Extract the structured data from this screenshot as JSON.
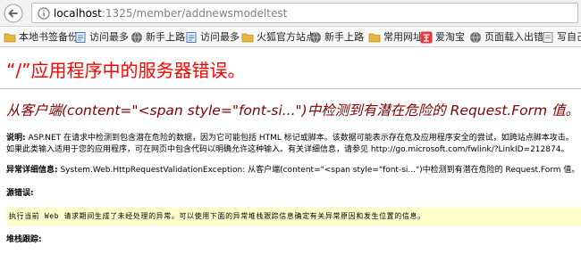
{
  "browser": {
    "url_host": "localhost",
    "url_path": ":1325/member/addnewsmodeltest",
    "bookmarks": [
      {
        "label": "本地书签备份",
        "icon": "folder-icon"
      },
      {
        "label": "访问最多",
        "icon": "bookmark-page-icon"
      },
      {
        "label": "新手上路",
        "icon": "globe-icon"
      },
      {
        "label": "访问最多",
        "icon": "bookmark-page-icon"
      },
      {
        "label": "火狐官方站点",
        "icon": "folder-icon"
      },
      {
        "label": "新手上路",
        "icon": "globe-icon"
      },
      {
        "label": "常用网址",
        "icon": "folder-icon"
      },
      {
        "label": "爱淘宝",
        "icon": "taobao-icon"
      },
      {
        "label": "页面载入出错",
        "icon": "globe-icon"
      },
      {
        "label": "写自己",
        "icon": "page-icon"
      }
    ],
    "colors": {
      "folder": "#e6b83a",
      "taobao": "#e4393c"
    }
  },
  "error_page": {
    "title": "“/”应用程序中的服务器错误。",
    "subtitle": "从客户端(content=\"<span style=\"font-si...\")中检测到有潜在危险的 Request.Form 值。",
    "description_label": "说明:",
    "description_text": " ASP.NET 在请求中检测到包含潜在危险的数据，因为它可能包括 HTML 标记或脚本。该数据可能表示存在危及应用程序安全的尝试，如跨站点脚本攻击。如果此类输入适用于您的应用程序，可在网页中包含代码以明确允许这种输入。有关详细信息，请参见 http://go.microsoft.com/fwlink/?LinkID=212874。",
    "exception_label": "异常详细信息:",
    "exception_text": " System.Web.HttpRequestValidationException: 从客户端(content=\"<span style=\"font-si...\")中检测到有潜在危险的 Request.Form 值。",
    "source_error_label": "源错误:",
    "source_error_text": "执行当前 Web 请求期间生成了未经处理的异常。可以使用下面的异常堆栈跟踪信息确定有关异常原因和发生位置的信息。",
    "stack_trace_label": "堆栈跟踪:",
    "colors": {
      "title": "#ff0000",
      "subtitle": "#800000",
      "source_box": "#ffffcc"
    }
  }
}
